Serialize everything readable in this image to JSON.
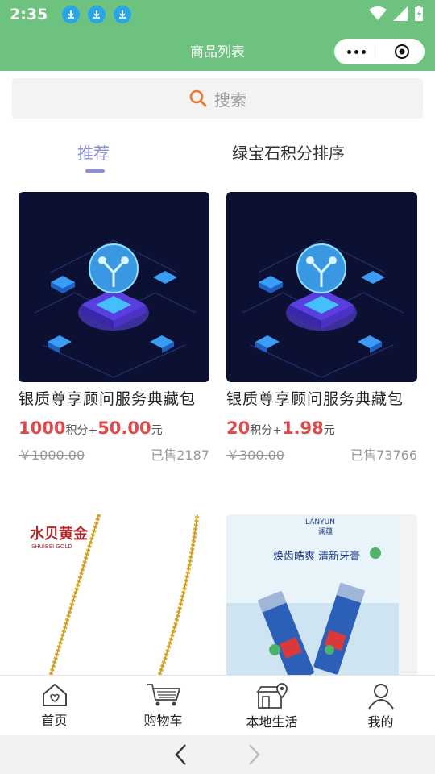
{
  "status_bar": {
    "time": "2:35"
  },
  "nav": {
    "title": "商品列表"
  },
  "search": {
    "placeholder": "搜索"
  },
  "tabs": [
    {
      "label": "推荐",
      "active": true
    },
    {
      "label": "绿宝石积分排序",
      "active": false
    }
  ],
  "products": [
    {
      "name": "银质尊享顾问服务典藏包",
      "points": "1000",
      "points_unit": "积分+",
      "cash": "50.00",
      "cash_unit": "元",
      "original_price": "￥1000.00",
      "sold": "已售2187",
      "image": "tech-illustration"
    },
    {
      "name": "银质尊享顾问服务典藏包",
      "points": "20",
      "points_unit": "积分+",
      "cash": "1.98",
      "cash_unit": "元",
      "original_price": "￥300.00",
      "sold": "已售73766",
      "image": "tech-illustration"
    },
    {
      "brand_text": "水贝黄金",
      "brand_sub": "SHUIBEI GOLD",
      "image": "gold-necklace"
    },
    {
      "brand_text": "LANYUN",
      "brand_cn": "澜蕴",
      "slogan": "焕齿皓爽 清新牙膏",
      "image": "toothpaste"
    }
  ],
  "tabbar": [
    {
      "label": "首页",
      "icon": "home-icon"
    },
    {
      "label": "购物车",
      "icon": "cart-icon"
    },
    {
      "label": "本地生活",
      "icon": "store-icon"
    },
    {
      "label": "我的",
      "icon": "user-icon"
    }
  ],
  "colors": {
    "primary": "#6cc27e",
    "accent": "#8b8fd6",
    "price": "#e04a4a"
  }
}
